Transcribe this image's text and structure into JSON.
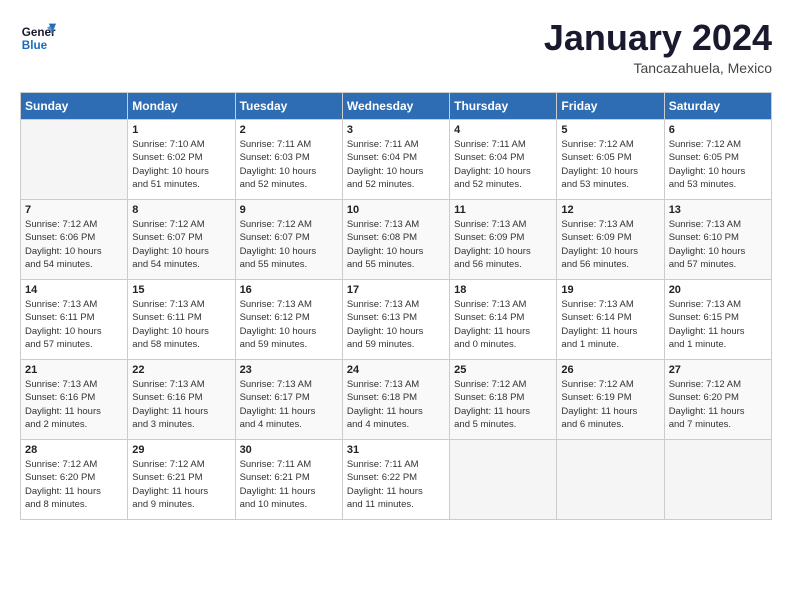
{
  "header": {
    "logo_line1": "General",
    "logo_line2": "Blue",
    "month_title": "January 2024",
    "location": "Tancazahuela, Mexico"
  },
  "days_of_week": [
    "Sunday",
    "Monday",
    "Tuesday",
    "Wednesday",
    "Thursday",
    "Friday",
    "Saturday"
  ],
  "weeks": [
    [
      {
        "day": "",
        "info": ""
      },
      {
        "day": "1",
        "info": "Sunrise: 7:10 AM\nSunset: 6:02 PM\nDaylight: 10 hours\nand 51 minutes."
      },
      {
        "day": "2",
        "info": "Sunrise: 7:11 AM\nSunset: 6:03 PM\nDaylight: 10 hours\nand 52 minutes."
      },
      {
        "day": "3",
        "info": "Sunrise: 7:11 AM\nSunset: 6:04 PM\nDaylight: 10 hours\nand 52 minutes."
      },
      {
        "day": "4",
        "info": "Sunrise: 7:11 AM\nSunset: 6:04 PM\nDaylight: 10 hours\nand 52 minutes."
      },
      {
        "day": "5",
        "info": "Sunrise: 7:12 AM\nSunset: 6:05 PM\nDaylight: 10 hours\nand 53 minutes."
      },
      {
        "day": "6",
        "info": "Sunrise: 7:12 AM\nSunset: 6:05 PM\nDaylight: 10 hours\nand 53 minutes."
      }
    ],
    [
      {
        "day": "7",
        "info": "Sunrise: 7:12 AM\nSunset: 6:06 PM\nDaylight: 10 hours\nand 54 minutes."
      },
      {
        "day": "8",
        "info": "Sunrise: 7:12 AM\nSunset: 6:07 PM\nDaylight: 10 hours\nand 54 minutes."
      },
      {
        "day": "9",
        "info": "Sunrise: 7:12 AM\nSunset: 6:07 PM\nDaylight: 10 hours\nand 55 minutes."
      },
      {
        "day": "10",
        "info": "Sunrise: 7:13 AM\nSunset: 6:08 PM\nDaylight: 10 hours\nand 55 minutes."
      },
      {
        "day": "11",
        "info": "Sunrise: 7:13 AM\nSunset: 6:09 PM\nDaylight: 10 hours\nand 56 minutes."
      },
      {
        "day": "12",
        "info": "Sunrise: 7:13 AM\nSunset: 6:09 PM\nDaylight: 10 hours\nand 56 minutes."
      },
      {
        "day": "13",
        "info": "Sunrise: 7:13 AM\nSunset: 6:10 PM\nDaylight: 10 hours\nand 57 minutes."
      }
    ],
    [
      {
        "day": "14",
        "info": "Sunrise: 7:13 AM\nSunset: 6:11 PM\nDaylight: 10 hours\nand 57 minutes."
      },
      {
        "day": "15",
        "info": "Sunrise: 7:13 AM\nSunset: 6:11 PM\nDaylight: 10 hours\nand 58 minutes."
      },
      {
        "day": "16",
        "info": "Sunrise: 7:13 AM\nSunset: 6:12 PM\nDaylight: 10 hours\nand 59 minutes."
      },
      {
        "day": "17",
        "info": "Sunrise: 7:13 AM\nSunset: 6:13 PM\nDaylight: 10 hours\nand 59 minutes."
      },
      {
        "day": "18",
        "info": "Sunrise: 7:13 AM\nSunset: 6:14 PM\nDaylight: 11 hours\nand 0 minutes."
      },
      {
        "day": "19",
        "info": "Sunrise: 7:13 AM\nSunset: 6:14 PM\nDaylight: 11 hours\nand 1 minute."
      },
      {
        "day": "20",
        "info": "Sunrise: 7:13 AM\nSunset: 6:15 PM\nDaylight: 11 hours\nand 1 minute."
      }
    ],
    [
      {
        "day": "21",
        "info": "Sunrise: 7:13 AM\nSunset: 6:16 PM\nDaylight: 11 hours\nand 2 minutes."
      },
      {
        "day": "22",
        "info": "Sunrise: 7:13 AM\nSunset: 6:16 PM\nDaylight: 11 hours\nand 3 minutes."
      },
      {
        "day": "23",
        "info": "Sunrise: 7:13 AM\nSunset: 6:17 PM\nDaylight: 11 hours\nand 4 minutes."
      },
      {
        "day": "24",
        "info": "Sunrise: 7:13 AM\nSunset: 6:18 PM\nDaylight: 11 hours\nand 4 minutes."
      },
      {
        "day": "25",
        "info": "Sunrise: 7:12 AM\nSunset: 6:18 PM\nDaylight: 11 hours\nand 5 minutes."
      },
      {
        "day": "26",
        "info": "Sunrise: 7:12 AM\nSunset: 6:19 PM\nDaylight: 11 hours\nand 6 minutes."
      },
      {
        "day": "27",
        "info": "Sunrise: 7:12 AM\nSunset: 6:20 PM\nDaylight: 11 hours\nand 7 minutes."
      }
    ],
    [
      {
        "day": "28",
        "info": "Sunrise: 7:12 AM\nSunset: 6:20 PM\nDaylight: 11 hours\nand 8 minutes."
      },
      {
        "day": "29",
        "info": "Sunrise: 7:12 AM\nSunset: 6:21 PM\nDaylight: 11 hours\nand 9 minutes."
      },
      {
        "day": "30",
        "info": "Sunrise: 7:11 AM\nSunset: 6:21 PM\nDaylight: 11 hours\nand 10 minutes."
      },
      {
        "day": "31",
        "info": "Sunrise: 7:11 AM\nSunset: 6:22 PM\nDaylight: 11 hours\nand 11 minutes."
      },
      {
        "day": "",
        "info": ""
      },
      {
        "day": "",
        "info": ""
      },
      {
        "day": "",
        "info": ""
      }
    ]
  ]
}
